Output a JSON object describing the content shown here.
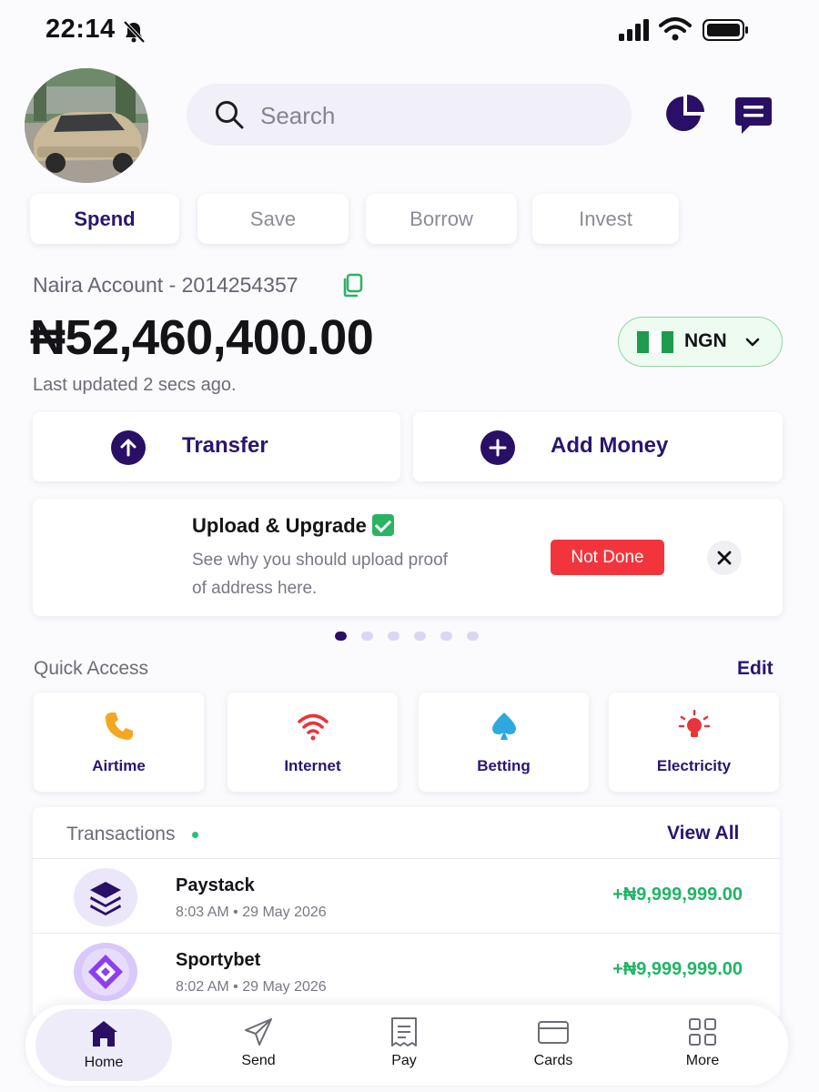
{
  "status_bar": {
    "time": "22:14"
  },
  "header": {
    "search_placeholder": "Search"
  },
  "tabs": [
    {
      "label": "Spend",
      "active": true
    },
    {
      "label": "Save",
      "active": false
    },
    {
      "label": "Borrow",
      "active": false
    },
    {
      "label": "Invest",
      "active": false
    }
  ],
  "account": {
    "label": "Naira Account - 2014254357",
    "balance": "₦52,460,400.00",
    "currency": "NGN",
    "updated": "Last updated 2 secs ago."
  },
  "actions": {
    "transfer": "Transfer",
    "add_money": "Add Money"
  },
  "promo": {
    "title": "Upload & Upgrade",
    "description": "See why you should upload proof of address here.",
    "status": "Not Done"
  },
  "carousel": {
    "total": 6,
    "active": 1
  },
  "quick_access": {
    "title": "Quick Access",
    "edit": "Edit",
    "items": [
      {
        "label": "Airtime",
        "icon": "phone-icon",
        "color": "#f5a623"
      },
      {
        "label": "Internet",
        "icon": "wifi-icon",
        "color": "#e8343a"
      },
      {
        "label": "Betting",
        "icon": "spade-icon",
        "color": "#2fa8e0"
      },
      {
        "label": "Electricity",
        "icon": "bulb-icon",
        "color": "#e8343a"
      }
    ]
  },
  "transactions": {
    "title": "Transactions",
    "view_all": "View All",
    "items": [
      {
        "name": "Paystack",
        "time": "8:03 AM • 29 May 2026",
        "amount": "+₦9,999,999.00",
        "icon": "layers-icon"
      },
      {
        "name": "Sportybet",
        "time": "8:02 AM • 29 May 2026",
        "amount": "+₦9,999,999.00",
        "icon": "diamond-icon"
      }
    ]
  },
  "bottom_nav": [
    {
      "label": "Home",
      "icon": "home-icon",
      "active": true
    },
    {
      "label": "Send",
      "icon": "send-icon",
      "active": false
    },
    {
      "label": "Pay",
      "icon": "receipt-icon",
      "active": false
    },
    {
      "label": "Cards",
      "icon": "card-icon",
      "active": false
    },
    {
      "label": "More",
      "icon": "grid-icon",
      "active": false
    }
  ],
  "colors": {
    "brand": "#2a0f66",
    "success": "#22b466",
    "danger": "#f2353d"
  }
}
